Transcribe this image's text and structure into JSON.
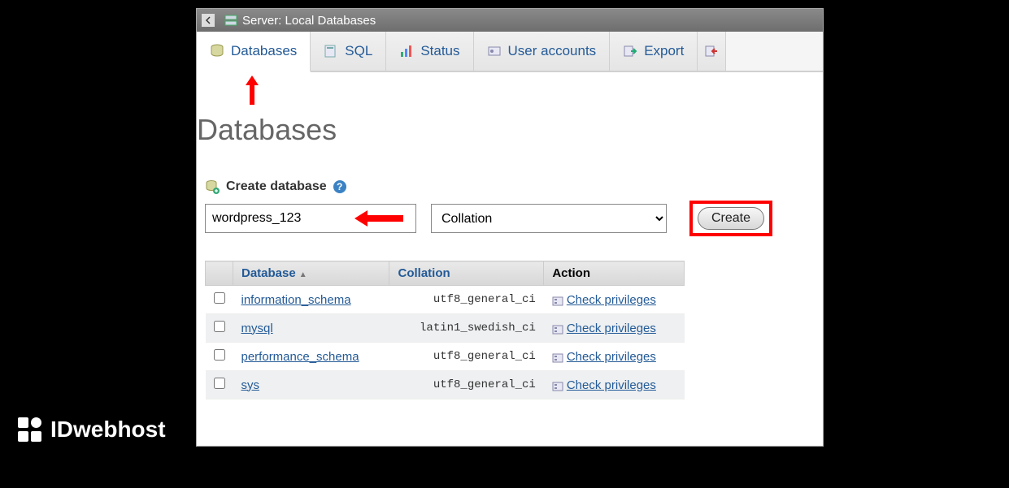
{
  "titlebar": {
    "label": "Server: Local Databases"
  },
  "tabs": [
    {
      "label": "Databases",
      "active": true
    },
    {
      "label": "SQL"
    },
    {
      "label": "Status"
    },
    {
      "label": "User accounts"
    },
    {
      "label": "Export"
    }
  ],
  "page": {
    "heading": "Databases"
  },
  "create": {
    "section_label": "Create database",
    "dbname_value": "wordpress_123",
    "collation_selected": "Collation",
    "button_label": "Create"
  },
  "table": {
    "headers": {
      "database": "Database",
      "collation": "Collation",
      "action": "Action"
    },
    "action_label": "Check privileges",
    "rows": [
      {
        "name": "information_schema",
        "collation": "utf8_general_ci"
      },
      {
        "name": "mysql",
        "collation": "latin1_swedish_ci"
      },
      {
        "name": "performance_schema",
        "collation": "utf8_general_ci"
      },
      {
        "name": "sys",
        "collation": "utf8_general_ci"
      }
    ]
  },
  "branding": {
    "logo_text": "IDwebhost"
  }
}
